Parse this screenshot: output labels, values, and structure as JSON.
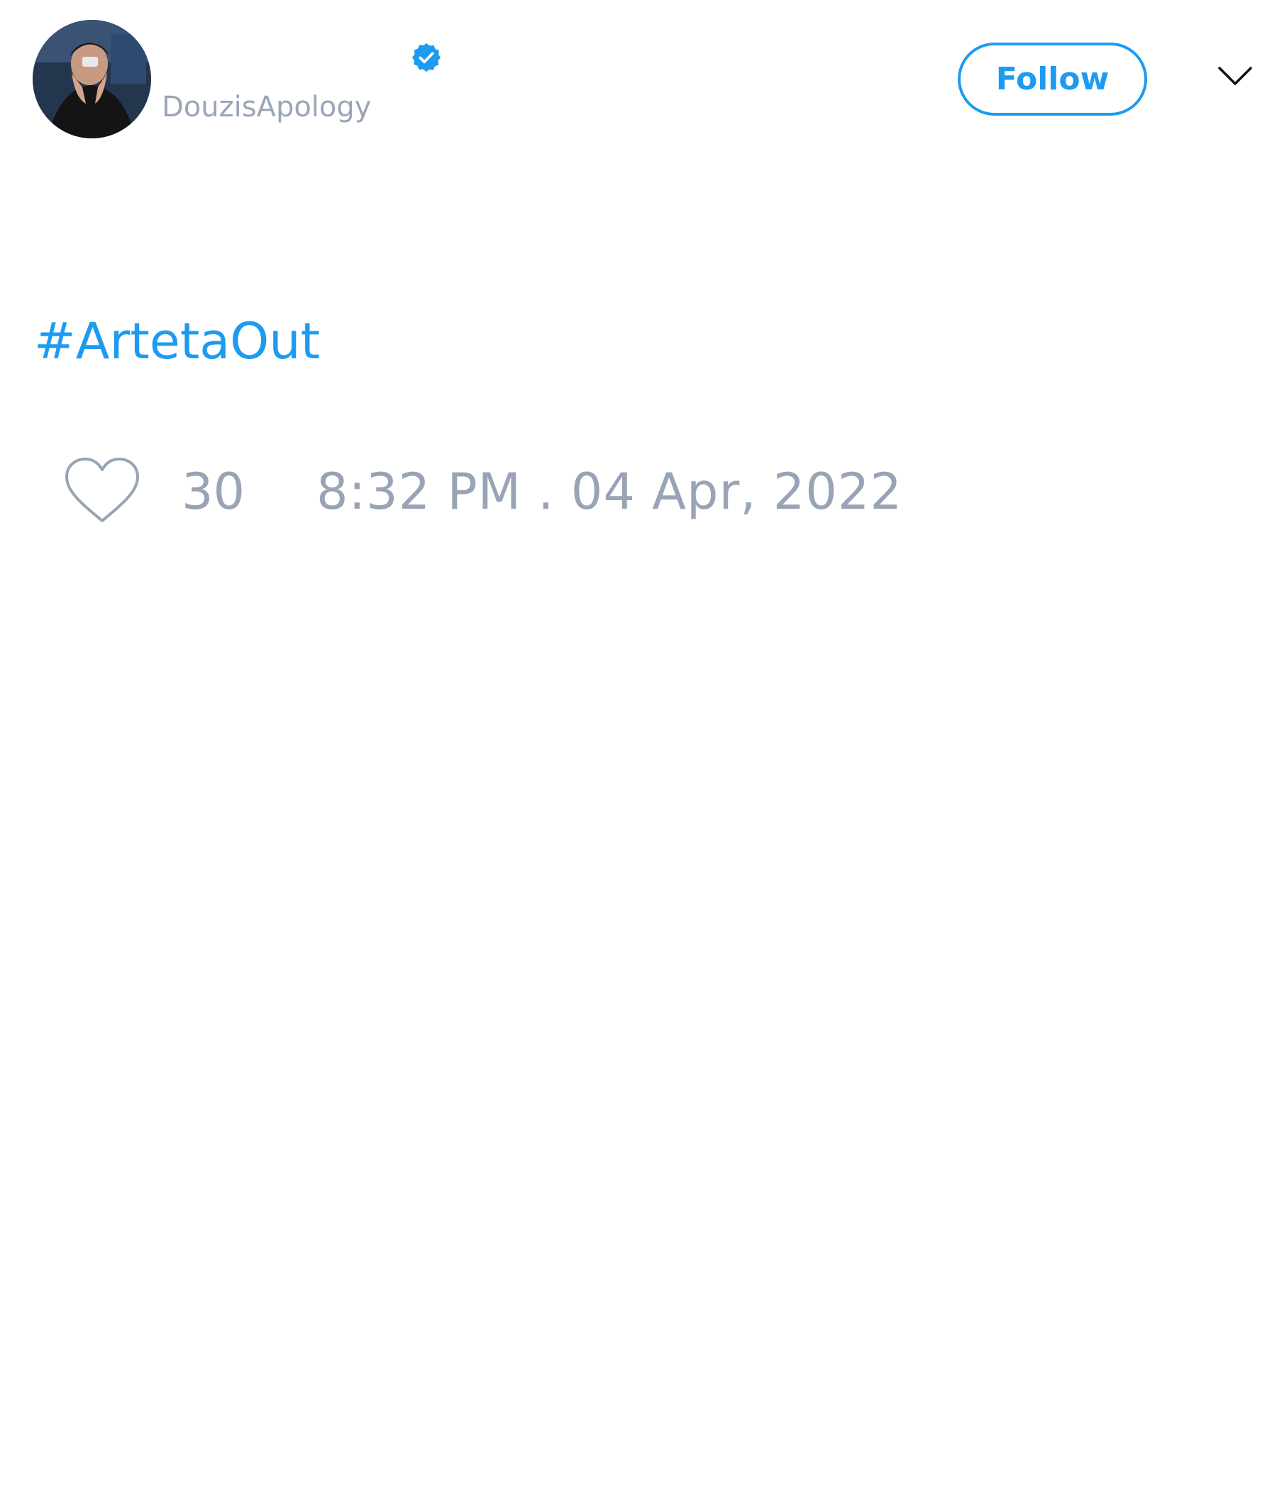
{
  "tweet": {
    "author": {
      "handle": "DouzisApology",
      "verified": true,
      "avatar": "avatar-photo"
    },
    "follow_label": "Follow",
    "menu_icon": "chevron-down-icon",
    "text": "#ArtetaOut",
    "likes": "30",
    "like_icon": "heart-outline-icon",
    "timestamp": "8:32 PM . 04 Apr, 2022"
  },
  "colors": {
    "accent": "#1d9bf0",
    "muted_text": "#98a4b6",
    "background": "#ffffff"
  }
}
